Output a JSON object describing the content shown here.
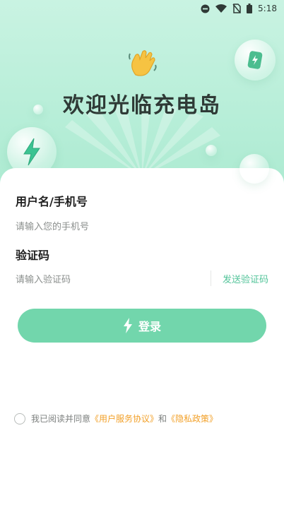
{
  "status_bar": {
    "time": "5:18",
    "icons": [
      "do-not-disturb-icon",
      "wifi-icon",
      "no-sim-icon",
      "battery-icon"
    ]
  },
  "hero": {
    "title": "欢迎光临充电岛",
    "wave_icon": "waving-hand-icon",
    "badges": [
      "power-bank-icon",
      "lightning-icon"
    ]
  },
  "form": {
    "username_label": "用户名/手机号",
    "username_placeholder": "请输入您的手机号",
    "code_label": "验证码",
    "code_placeholder": "请输入验证码",
    "send_code": "发送验证码"
  },
  "login_button": {
    "label": "登录",
    "icon": "lightning-icon"
  },
  "agreement": {
    "prefix": "我已阅读并同意",
    "service_link": "《用户服务协议》",
    "and": "和",
    "privacy_link": "《隐私政策》"
  },
  "colors": {
    "accent": "#72d6ac",
    "link": "#f2a028",
    "hero_bg": "#b7eed8"
  }
}
